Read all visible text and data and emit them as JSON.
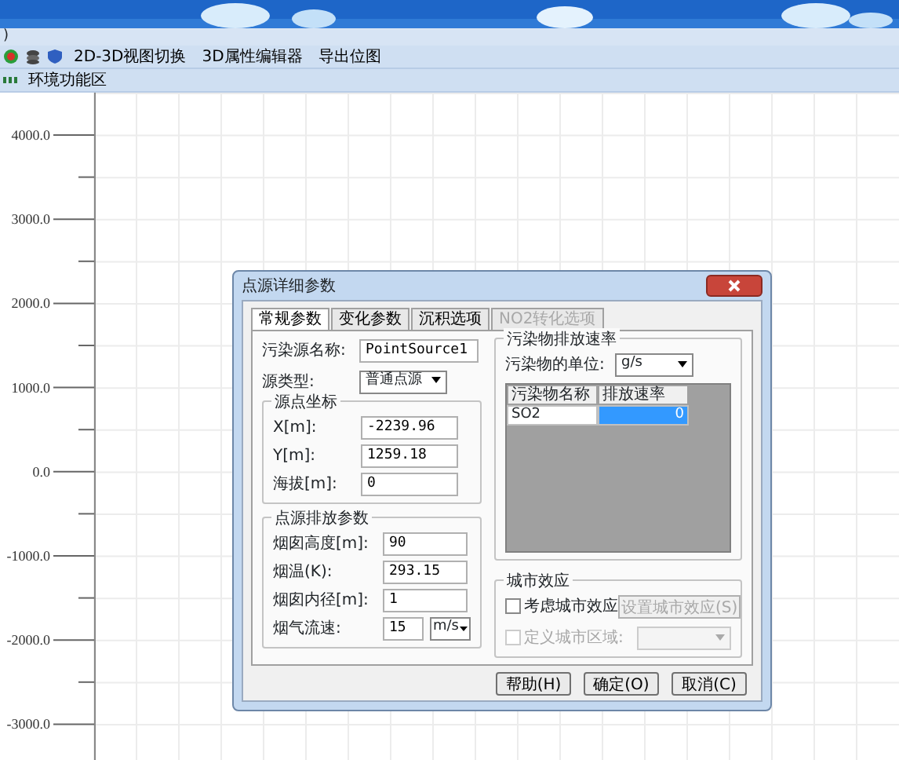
{
  "menu_bar": {
    "partial_text": ")"
  },
  "toolbar": {
    "buttons": [
      "2D-3D视图切换",
      "3D属性编辑器",
      "导出位图"
    ]
  },
  "toolbar2": {
    "buttons": [
      "环境功能区"
    ]
  },
  "plot": {
    "y_labels": [
      "4000.0",
      "3000.0",
      "2000.0",
      "1000.0",
      "0.0",
      "-1000.0",
      "-2000.0",
      "-3000.0"
    ]
  },
  "dialog": {
    "title": "点源详细参数",
    "tabs": [
      {
        "label": "常规参数",
        "selected": true,
        "disabled": false
      },
      {
        "label": "变化参数",
        "selected": false,
        "disabled": false
      },
      {
        "label": "沉积选项",
        "selected": false,
        "disabled": false
      },
      {
        "label": "NO2转化选项",
        "selected": false,
        "disabled": true
      }
    ],
    "source_name": {
      "label": "污染源名称:",
      "value": "PointSource1"
    },
    "source_type": {
      "label": "源类型:",
      "value": "普通点源"
    },
    "coords": {
      "title": "源点坐标",
      "fields": [
        {
          "label": "X[m]:",
          "value": "-2239.96"
        },
        {
          "label": "Y[m]:",
          "value": "1259.18"
        },
        {
          "label": "海拔[m]:",
          "value": "0"
        }
      ]
    },
    "emission": {
      "title": "点源排放参数",
      "fields": [
        {
          "label": "烟囱高度[m]:",
          "value": "90"
        },
        {
          "label": "烟温(K):",
          "value": "293.15"
        },
        {
          "label": "烟囱内径[m]:",
          "value": "1"
        }
      ],
      "velocity": {
        "label": "烟气流速:",
        "value": "15",
        "unit": "m/s"
      }
    },
    "rates": {
      "title": "污染物排放速率",
      "unit_label": "污染物的单位:",
      "unit": "g/s",
      "columns": [
        "污染物名称",
        "排放速率"
      ],
      "rows": [
        {
          "name": "SO2",
          "rate": "0",
          "selected": true
        }
      ]
    },
    "urban": {
      "title": "城市效应",
      "consider": {
        "label": "考虑城市效应",
        "checked": false,
        "disabled": false
      },
      "set_button": {
        "label": "设置城市效应(S)",
        "disabled": true
      },
      "define": {
        "label": "定义城市区域:",
        "checked": false,
        "disabled": true
      },
      "region_combo": {
        "disabled": true
      }
    },
    "buttons": [
      "帮助(H)",
      "确定(O)",
      "取消(C)"
    ]
  }
}
